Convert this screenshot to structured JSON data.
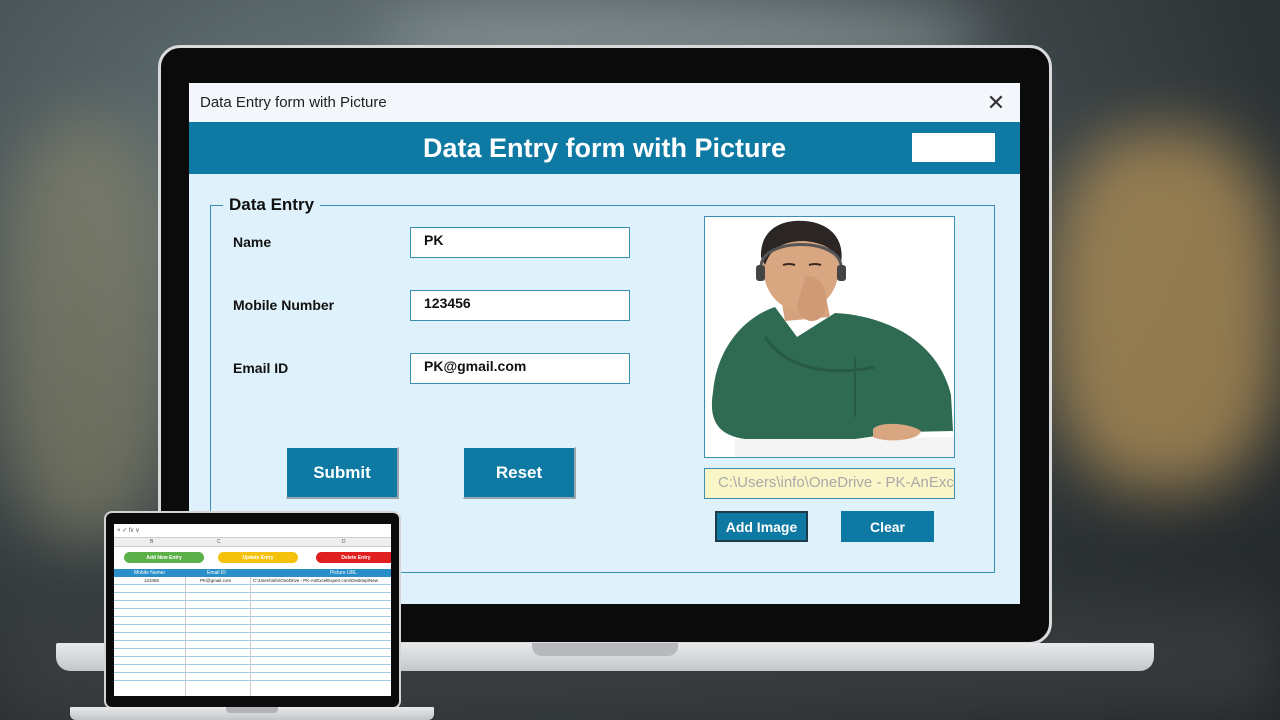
{
  "dialog": {
    "window_title": "Data Entry form with Picture",
    "banner_title": "Data Entry form with Picture",
    "frame_title": "Data Entry",
    "fields": {
      "name_label": "Name",
      "name_value": "PK",
      "mobile_label": "Mobile Number",
      "mobile_value": "123456",
      "email_label": "Email ID",
      "email_value": "PK@gmail.com"
    },
    "buttons": {
      "submit": "Submit",
      "reset": "Reset",
      "add_image": "Add Image",
      "clear": "Clear"
    },
    "picture_path": "C:\\Users\\info\\OneDrive - PK-AnExcelE",
    "accent_color": "#0e7aa4",
    "background_color": "#dff2fb"
  },
  "spreadsheet": {
    "formula_bar": "×  ✓  fx  ∨",
    "column_letters": [
      "B",
      "C",
      "D"
    ],
    "buttons": {
      "add": "Add New Entry",
      "update": "Update Entry",
      "delete": "Delete Entry"
    },
    "button_colors": {
      "add": "#5bb04a",
      "update": "#f4c20d",
      "delete": "#e02020"
    },
    "headers": [
      "Mobile Numer",
      "Email ID",
      "Picture URL"
    ],
    "rows": [
      [
        "123456",
        "PK@gmail.com",
        "C:\\Users\\info\\OneDrive - PK-AnExcelExpert.com\\Desktop\\New"
      ]
    ]
  }
}
